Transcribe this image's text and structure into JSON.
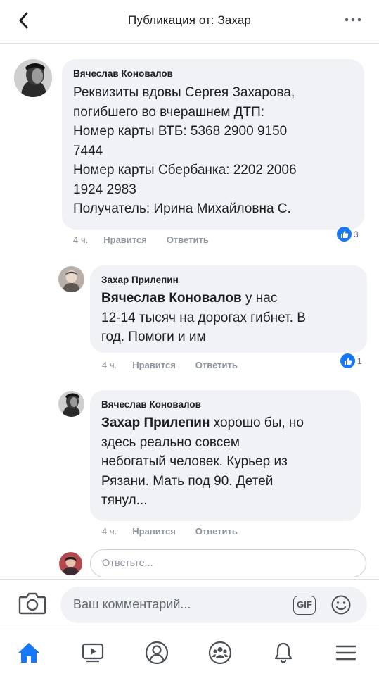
{
  "header": {
    "title": "Публикация от: Захар"
  },
  "comments": [
    {
      "author": "Вячеслав Коновалов",
      "lines": [
        "Реквизиты вдовы Сергея Захарова,",
        "погибшего во вчерашнем ДТП:",
        "Номер карты ВТБ: 5368 2900 9150",
        "7444",
        "Номер карты Сбербанка: 2202 2006",
        "1924 2983",
        "Получатель: Ирина Михайловна С."
      ],
      "time": "4 ч.",
      "like_label": "Нравится",
      "reply_label": "Ответить",
      "reaction_count": "3"
    },
    {
      "author": "Захар Прилепин",
      "mention": "Вячеслав Коновалов",
      "first_line_rest": " у нас",
      "lines": [
        "12-14 тысяч на дорогах гибнет. В",
        "год. Помоги и им"
      ],
      "time": "4 ч.",
      "like_label": "Нравится",
      "reply_label": "Ответить",
      "reaction_count": "1"
    },
    {
      "author": "Вячеслав Коновалов",
      "mention": "Захар Прилепин",
      "first_line_rest": " хорошо бы, но",
      "lines": [
        "здесь реально совсем",
        "небогатый человек. Курьер из",
        "Рязани. Мать под 90. Детей",
        "тянул..."
      ],
      "time": "4 ч.",
      "like_label": "Нравится",
      "reply_label": "Ответить"
    }
  ],
  "reply_box": {
    "placeholder": "Ответьте..."
  },
  "composer": {
    "placeholder": "Ваш комментарий...",
    "gif_label": "GIF"
  },
  "tabbar": {
    "tabs": [
      "home-icon",
      "watch-icon",
      "profile-icon",
      "groups-icon",
      "notifications-icon",
      "menu-icon"
    ],
    "active": "home-icon"
  },
  "colors": {
    "accent": "#1877f2",
    "bubble": "#f0f2f5",
    "meta_text": "#8d949e"
  }
}
